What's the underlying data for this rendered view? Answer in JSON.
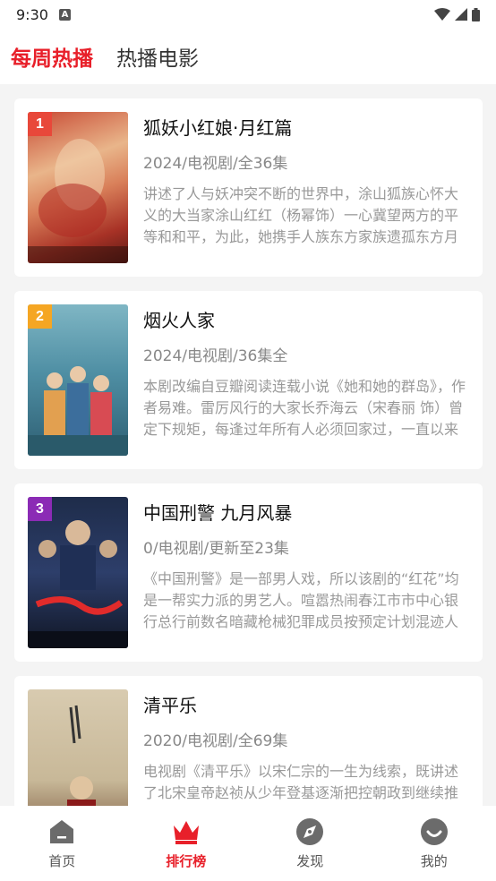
{
  "status_bar": {
    "time": "9:30",
    "notification_icon": "a-icon"
  },
  "header": {
    "tabs": [
      {
        "label": "每周热播",
        "active": true
      },
      {
        "label": "热播电影",
        "active": false
      }
    ]
  },
  "colors": {
    "accent": "#e8202a",
    "rank1": "#e8483a",
    "rank2": "#f5a623",
    "rank3": "#8b2bb5"
  },
  "shows": [
    {
      "rank": "1",
      "title": "狐妖小红娘·月红篇",
      "meta": "2024/电视剧/全36集",
      "desc": "讲述了人与妖冲突不断的世界中，涂山狐族心怀大义的大当家涂山红红（杨幂饰）一心冀望两方的平等和和平，为此，她携手人族东方家族遗孤东方月初（龚俊饰），开启…"
    },
    {
      "rank": "2",
      "title": "烟火人家",
      "meta": "2024/电视剧/36集全",
      "desc": "本剧改编自豆瓣阅读连载小说《她和她的群岛》，作者易难。雷厉风行的大家长乔海云（宋春丽 饰）曾定下规矩，每逢过年所有人必须回家过，一直以来从未有人坏过规矩…"
    },
    {
      "rank": "3",
      "title": "中国刑警 九月风暴",
      "meta": "0/电视剧/更新至23集",
      "desc": "《中国刑警》是一部男人戏，所以该剧的“红花”均是一帮实力派的男艺人。喧嚣热闹春江市市中心银行总行前数名暗藏枪械犯罪成员按预定计划混迹人群中等待着下达…"
    },
    {
      "rank": "",
      "title": "清平乐",
      "meta": "2020/电视剧/全69集",
      "desc": "电视剧《清平乐》以宋仁宗的一生为线索，既讲述了北宋皇帝赵祯从少年登基逐渐把控朝政到继续推行新政的故事，也表现了…"
    }
  ],
  "bottom_nav": [
    {
      "label": "首页",
      "icon": "home-icon",
      "active": false
    },
    {
      "label": "排行榜",
      "icon": "crown-icon",
      "active": true
    },
    {
      "label": "发现",
      "icon": "discover-icon",
      "active": false
    },
    {
      "label": "我的",
      "icon": "profile-icon",
      "active": false
    }
  ]
}
